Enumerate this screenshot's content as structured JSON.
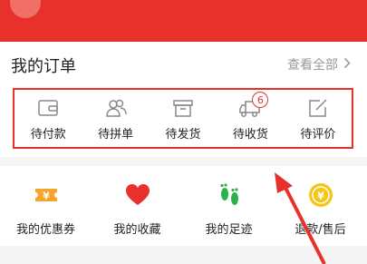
{
  "orders": {
    "title": "我的订单",
    "view_all": "查看全部",
    "statuses": [
      {
        "label": "待付款",
        "icon": "wallet-icon"
      },
      {
        "label": "待拼单",
        "icon": "group-icon"
      },
      {
        "label": "待发货",
        "icon": "box-icon"
      },
      {
        "label": "待收货",
        "icon": "truck-icon",
        "badge": "6"
      },
      {
        "label": "待评价",
        "icon": "review-icon"
      }
    ]
  },
  "services": [
    {
      "label": "我的优惠券",
      "icon": "coupon-icon"
    },
    {
      "label": "我的收藏",
      "icon": "heart-icon"
    },
    {
      "label": "我的足迹",
      "icon": "footprint-icon"
    },
    {
      "label": "退款/售后",
      "icon": "refund-coin-icon"
    }
  ],
  "colors": {
    "brand_red": "#e8312b",
    "coupon_orange": "#f4a52a",
    "footprint_green": "#2ab34b",
    "coin_yellow": "#f5c518",
    "annotation_red": "#e8312b"
  }
}
